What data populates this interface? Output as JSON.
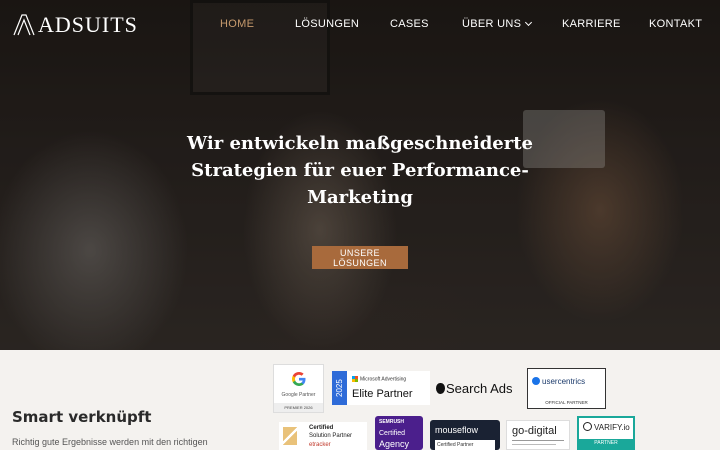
{
  "brand": {
    "name": "ADSUITS",
    "accent": "#c79a6d",
    "cta_color": "#a86a3c"
  },
  "nav": {
    "items": [
      {
        "label": "HOME",
        "active": true
      },
      {
        "label": "LÖSUNGEN"
      },
      {
        "label": "CASES"
      },
      {
        "label": "ÜBER UNS",
        "dropdown": true
      },
      {
        "label": "KARRIERE"
      },
      {
        "label": "KONTAKT"
      }
    ]
  },
  "hero": {
    "headline_lines": [
      "Wir entwickeln maßgeschneiderte",
      "Strategien für euer Performance-",
      "Marketing"
    ],
    "cta": "UNSERE LÖSUNGEN"
  },
  "section": {
    "title": "Smart verknüpft",
    "text": "Richtig gute Ergebnisse werden mit den richtigen"
  },
  "badges": {
    "google": {
      "name": "Google Partner",
      "premier": "PREMIER 2026"
    },
    "microsoft": {
      "year": "2025",
      "vendor": "Microsoft Advertising",
      "tier": "Elite Partner"
    },
    "apple": {
      "label": "Search Ads"
    },
    "usercentrics": {
      "name": "usercentrics",
      "status": "OFFICIAL PARTNER"
    },
    "etracker": {
      "line1": "Certified",
      "line2": "Solution Partner",
      "line3": "etracker"
    },
    "semrush": {
      "vendor": "SEMRUSH",
      "line1": "Certified",
      "line2": "Agency"
    },
    "mouseflow": {
      "name": "mouseflow",
      "sub": "Certified Partner"
    },
    "godigital": {
      "name": "go-digital"
    },
    "varify": {
      "name": "VARIFY.io",
      "status": "PARTNER"
    }
  }
}
